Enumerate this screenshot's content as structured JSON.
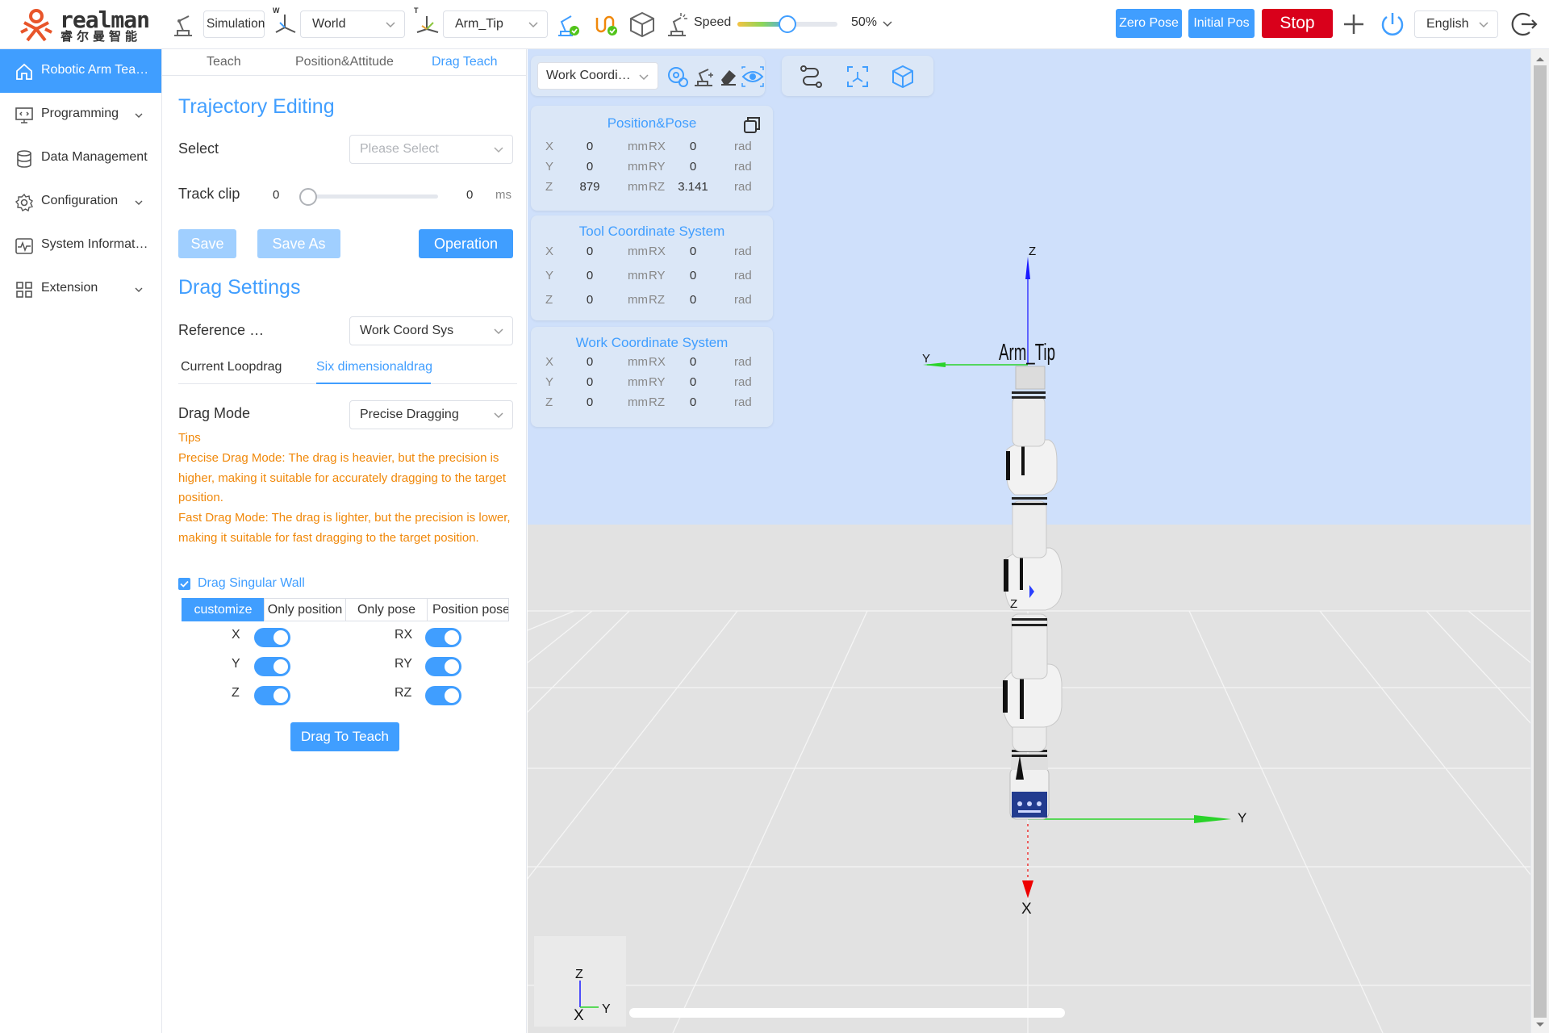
{
  "app": {
    "brand": "realman",
    "brand_sub": "睿尔曼智能"
  },
  "toolbar": {
    "mode_value": "Simulation",
    "frame_tag": "W",
    "frame_value": "World",
    "tool_tag": "T",
    "tool_value": "Arm_Tip",
    "speed_label": "Speed",
    "speed_percent": 50,
    "speed_value_text": "50%",
    "zero_pose": "Zero Pose",
    "initial_pos": "Initial Pos",
    "stop": "Stop",
    "language": "English"
  },
  "sidebar": {
    "items": [
      {
        "label": "Robotic Arm Teaching",
        "icon": "home-icon",
        "active": true,
        "expandable": false
      },
      {
        "label": "Programming",
        "icon": "code-monitor-icon",
        "active": false,
        "expandable": true
      },
      {
        "label": "Data Management",
        "icon": "database-icon",
        "active": false,
        "expandable": false
      },
      {
        "label": "Configuration",
        "icon": "gear-icon",
        "active": false,
        "expandable": true
      },
      {
        "label": "System Information",
        "icon": "pulse-monitor-icon",
        "active": false,
        "expandable": false
      },
      {
        "label": "Extension",
        "icon": "grid-icon",
        "active": false,
        "expandable": true
      }
    ]
  },
  "panel": {
    "tabs": [
      "Teach",
      "Position&Attitude",
      "Drag Teach"
    ],
    "active_tab": 2,
    "trajectory": {
      "title": "Trajectory Editing",
      "select_label": "Select",
      "select_placeholder": "Please Select",
      "track_label": "Track clip",
      "track_min": "0",
      "track_max": "0",
      "track_unit": "ms",
      "save": "Save",
      "save_as": "Save As",
      "operation": "Operation"
    },
    "drag": {
      "title": "Drag Settings",
      "reference_label": "Reference coordinate",
      "reference_value": "Work Coord Sys",
      "sub_tabs": [
        "Current Loopdrag",
        "Six dimensionaldrag"
      ],
      "active_sub_tab": 1,
      "mode_label": "Drag Mode",
      "mode_value": "Precise Dragging",
      "tips_title": "Tips",
      "tip_precise": "Precise Drag Mode: The drag is heavier, but the precision is higher, making it suitable for accurately dragging to the target position.",
      "tip_fast": "Fast Drag Mode: The drag is lighter, but the precision is lower, making it suitable for fast dragging to the target position.",
      "singular_wall_label": "Drag Singular Wall",
      "singular_wall_checked": true,
      "segments": [
        "customize",
        "Only position",
        "Only pose",
        "Position pose"
      ],
      "active_segment": 0,
      "axes": [
        {
          "name": "X",
          "on": true
        },
        {
          "name": "RX",
          "on": true
        },
        {
          "name": "Y",
          "on": true
        },
        {
          "name": "RY",
          "on": true
        },
        {
          "name": "Z",
          "on": true
        },
        {
          "name": "RZ",
          "on": true
        }
      ],
      "drag_button": "Drag To Teach"
    }
  },
  "viewport": {
    "coord_select": "Work Coordinate",
    "cards": [
      {
        "title": "Position&Pose",
        "rows": [
          {
            "a": "X",
            "av": "0",
            "au": "mm",
            "b": "RX",
            "bv": "0",
            "bu": "rad"
          },
          {
            "a": "Y",
            "av": "0",
            "au": "mm",
            "b": "RY",
            "bv": "0",
            "bu": "rad"
          },
          {
            "a": "Z",
            "av": "879",
            "au": "mm",
            "b": "RZ",
            "bv": "3.141",
            "bu": "rad"
          }
        ]
      },
      {
        "title": "Tool Coordinate System",
        "rows": [
          {
            "a": "X",
            "av": "0",
            "au": "mm",
            "b": "RX",
            "bv": "0",
            "bu": "rad"
          },
          {
            "a": "Y",
            "av": "0",
            "au": "mm",
            "b": "RY",
            "bv": "0",
            "bu": "rad"
          },
          {
            "a": "Z",
            "av": "0",
            "au": "mm",
            "b": "RZ",
            "bv": "0",
            "bu": "rad"
          }
        ]
      },
      {
        "title": "Work Coordinate System",
        "rows": [
          {
            "a": "X",
            "av": "0",
            "au": "mm",
            "b": "RX",
            "bv": "0",
            "bu": "rad"
          },
          {
            "a": "Y",
            "av": "0",
            "au": "mm",
            "b": "RY",
            "bv": "0",
            "bu": "rad"
          },
          {
            "a": "Z",
            "av": "0",
            "au": "mm",
            "b": "RZ",
            "bv": "0",
            "bu": "rad"
          }
        ]
      }
    ],
    "scene_labels": {
      "tip_label": "Arm_Tip",
      "tip_z": "Z",
      "tip_y": "Y",
      "base_y": "Y",
      "base_x": "X",
      "mid_z": "Z",
      "gizmo_z": "Z",
      "gizmo_y": "Y",
      "gizmo_x": "X"
    },
    "colors": {
      "sky": "#cfe0fb",
      "floor": "#e2e2e2",
      "accent": "#409eff",
      "stop": "#d9001b",
      "tips": "#f0880a"
    }
  }
}
